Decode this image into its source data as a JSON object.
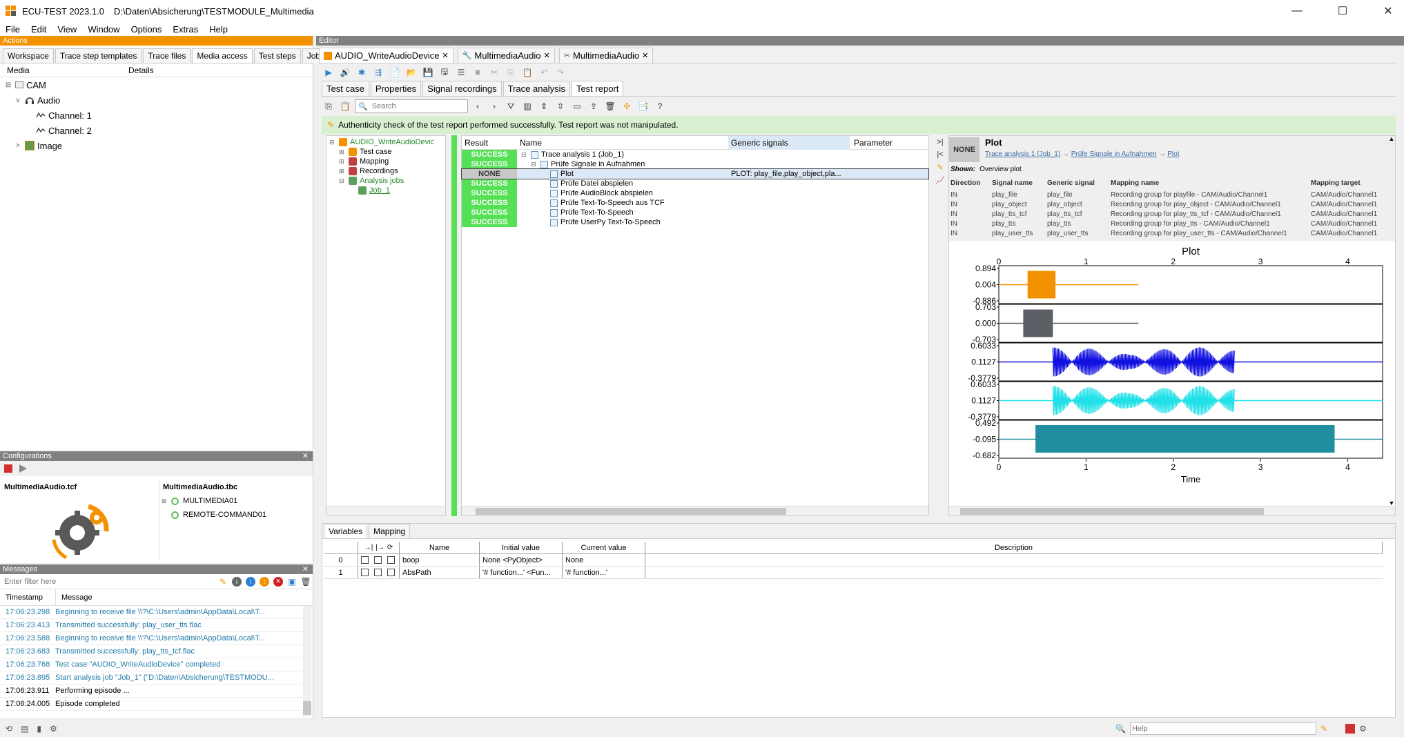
{
  "window": {
    "title": "ECU-TEST 2023.1.0",
    "path": "D:\\Daten\\Absicherung\\TESTMODULE_Multimedia",
    "minimize": "—",
    "maximize": "☐",
    "close": "✕"
  },
  "menu": [
    "File",
    "Edit",
    "View",
    "Window",
    "Options",
    "Extras",
    "Help"
  ],
  "actions": {
    "header": "Actions",
    "tabs": [
      "Workspace",
      "Trace step templates",
      "Trace files",
      "Media access",
      "Test steps",
      "Jobs"
    ],
    "active_tab": "Media access",
    "columns": [
      "Media",
      "Details"
    ],
    "tree": [
      {
        "label": "CAM",
        "level": 0,
        "expander": "⊟"
      },
      {
        "label": "Audio",
        "level": 1,
        "expander": "v"
      },
      {
        "label": "Channel: 1",
        "level": 2,
        "expander": ""
      },
      {
        "label": "Channel: 2",
        "level": 2,
        "expander": ""
      },
      {
        "label": "Image",
        "level": 1,
        "expander": ">"
      }
    ]
  },
  "configurations": {
    "header": "Configurations",
    "tcf": "MultimediaAudio.tcf",
    "tbc": "MultimediaAudio.tbc",
    "items": [
      "MULTIMEDIA01",
      "REMOTE-COMMAND01"
    ]
  },
  "messages": {
    "header": "Messages",
    "filter_placeholder": "Enter filter here",
    "columns": [
      "Timestamp",
      "Message"
    ],
    "rows": [
      {
        "ts": "17:06:23.298",
        "msg": "Beginning to receive file \\\\?\\C:\\Users\\admin\\AppData\\Local\\T...",
        "blue": true
      },
      {
        "ts": "17:06:23.413",
        "msg": "Transmitted successfully: play_user_tts.flac",
        "blue": true
      },
      {
        "ts": "17:06:23.588",
        "msg": "Beginning to receive file \\\\?\\C:\\Users\\admin\\AppData\\Local\\T...",
        "blue": true
      },
      {
        "ts": "17:06:23.683",
        "msg": "Transmitted successfully: play_tts_tcf.flac",
        "blue": true
      },
      {
        "ts": "17:06:23.768",
        "msg": "Test case \"AUDIO_WriteAudioDevice\" completed",
        "blue": true
      },
      {
        "ts": "17:06:23.895",
        "msg": "Start analysis job \"Job_1\" (\"D:\\Daten\\Absicherung\\TESTMODU...",
        "blue": true
      },
      {
        "ts": "17:06:23.911",
        "msg": "Performing episode ...",
        "blue": false
      },
      {
        "ts": "17:06:24.005",
        "msg": "Episode completed",
        "blue": false
      }
    ]
  },
  "editor": {
    "header": "Editor",
    "doc_tabs": [
      "AUDIO_WriteAudioDevice",
      "MultimediaAudio",
      "MultimediaAudio"
    ],
    "sub_tabs": [
      "Test case",
      "Properties",
      "Signal recordings",
      "Trace analysis",
      "Test report"
    ],
    "active_sub_tab": "Test report",
    "search_placeholder": "Search",
    "auth_msg": "Authenticity check of the test report performed successfully. Test report was not manipulated.",
    "tree": [
      {
        "label": "AUDIO_WriteAudioDevic",
        "level": 0,
        "green": true
      },
      {
        "label": "Test case",
        "level": 1,
        "green": false
      },
      {
        "label": "Mapping",
        "level": 1,
        "green": false
      },
      {
        "label": "Recordings",
        "level": 1,
        "green": false
      },
      {
        "label": "Analysis jobs",
        "level": 1,
        "green": true
      },
      {
        "label": "Job_1",
        "level": 2,
        "green": true
      }
    ],
    "grid_columns": [
      "Result",
      "Name",
      "Generic signals",
      "Parameter"
    ],
    "grid_rows": [
      {
        "result": "SUCCESS",
        "name": "Trace analysis 1 (Job_1)",
        "indent": 0,
        "signals": ""
      },
      {
        "result": "SUCCESS",
        "name": "Prüfe Signale in Aufnahmen",
        "indent": 1,
        "signals": ""
      },
      {
        "result": "NONE",
        "name": "Plot",
        "indent": 2,
        "signals": "PLOT: play_file,play_object,pla..."
      },
      {
        "result": "SUCCESS",
        "name": "Prüfe Datei abspielen",
        "indent": 2,
        "signals": ""
      },
      {
        "result": "SUCCESS",
        "name": "Prüfe AudioBlock abspielen",
        "indent": 2,
        "signals": ""
      },
      {
        "result": "SUCCESS",
        "name": "Prüfe Text-To-Speech aus TCF",
        "indent": 2,
        "signals": ""
      },
      {
        "result": "SUCCESS",
        "name": "Prüfe Text-To-Speech",
        "indent": 2,
        "signals": ""
      },
      {
        "result": "SUCCESS",
        "name": "Prüfe UserPy Text-To-Speech",
        "indent": 2,
        "signals": ""
      }
    ]
  },
  "detail": {
    "result": "NONE",
    "title": "Plot",
    "breadcrumb": [
      "Trace analysis 1 (Job_1)",
      "Prüfe Signale in Aufnahmen",
      "Plot"
    ],
    "arrow": "→",
    "shown_label": "Shown:",
    "shown_value": "Overview plot",
    "mapping_columns": [
      "Direction",
      "Signal name",
      "Generic signal",
      "Mapping name",
      "Mapping target"
    ],
    "mapping_rows": [
      [
        "IN",
        "play_file",
        "play_file",
        "Recording group for playfile - CAM/Audio/Channel1",
        "CAM/Audio/Channel1"
      ],
      [
        "IN",
        "play_object",
        "play_object",
        "Recording group for play_object - CAM/Audio/Channel1",
        "CAM/Audio/Channel1"
      ],
      [
        "IN",
        "play_tts_tcf",
        "play_tts_tcf",
        "Recording group for play_tts_tcf - CAM/Audio/Channel1",
        "CAM/Audio/Channel1"
      ],
      [
        "IN",
        "play_tts",
        "play_tts",
        "Recording group for play_tts - CAM/Audio/Channel1",
        "CAM/Audio/Channel1"
      ],
      [
        "IN",
        "play_user_tts",
        "play_user_tts",
        "Recording group for play_user_tts - CAM/Audio/Channel1",
        "CAM/Audio/Channel1"
      ]
    ]
  },
  "chart_data": {
    "type": "line",
    "title": "Plot",
    "xlabel": "Time",
    "xlim": [
      0,
      4.4
    ],
    "xticks": [
      "0",
      "1",
      "2",
      "3",
      "4"
    ],
    "series": [
      {
        "color": "#f39200",
        "yticks": [
          "0.894",
          "0.004",
          "-0.886"
        ],
        "ylim": [
          -0.886,
          0.894
        ],
        "active": [
          0.33,
          0.65
        ],
        "end": 1.6,
        "shape": "block"
      },
      {
        "color": "#5b5f66",
        "yticks": [
          "0.703",
          "0.000",
          "-0.703"
        ],
        "ylim": [
          -0.703,
          0.703
        ],
        "active": [
          0.28,
          0.62
        ],
        "end": 1.6,
        "shape": "block"
      },
      {
        "color": "#1010e0",
        "yticks": [
          "0.6033",
          "0.1127",
          "-0.3779"
        ],
        "ylim": [
          -0.3779,
          0.6033
        ],
        "active": [
          0.62,
          2.7
        ],
        "end": 4.4,
        "shape": "speech"
      },
      {
        "color": "#20e0e8",
        "yticks": [
          "0.6033",
          "0.1127",
          "-0.3779"
        ],
        "ylim": [
          -0.3779,
          0.6033
        ],
        "active": [
          0.62,
          2.7
        ],
        "end": 4.4,
        "shape": "speech"
      },
      {
        "color": "#1f8fa0",
        "yticks": [
          "0.492",
          "-0.095",
          "-0.682"
        ],
        "ylim": [
          -0.682,
          0.492
        ],
        "active": [
          0.42,
          3.85
        ],
        "end": 4.4,
        "shape": "block"
      }
    ]
  },
  "variables": {
    "tabs": [
      "Variables",
      "Mapping"
    ],
    "columns": [
      "Name",
      "Initial value",
      "Current value",
      "Description"
    ],
    "rows": [
      {
        "idx": "0",
        "name": "boop",
        "initial": "None <PyObject>",
        "current": "None"
      },
      {
        "idx": "1",
        "name": "AbsPath",
        "initial": "'# function...' <Fun...",
        "current": "'# function...'"
      }
    ]
  },
  "statusbar": {
    "help_placeholder": "Help"
  },
  "colors": {
    "accent": "#f39200",
    "success": "#55e055",
    "auth_bg": "#d8f0d0"
  }
}
